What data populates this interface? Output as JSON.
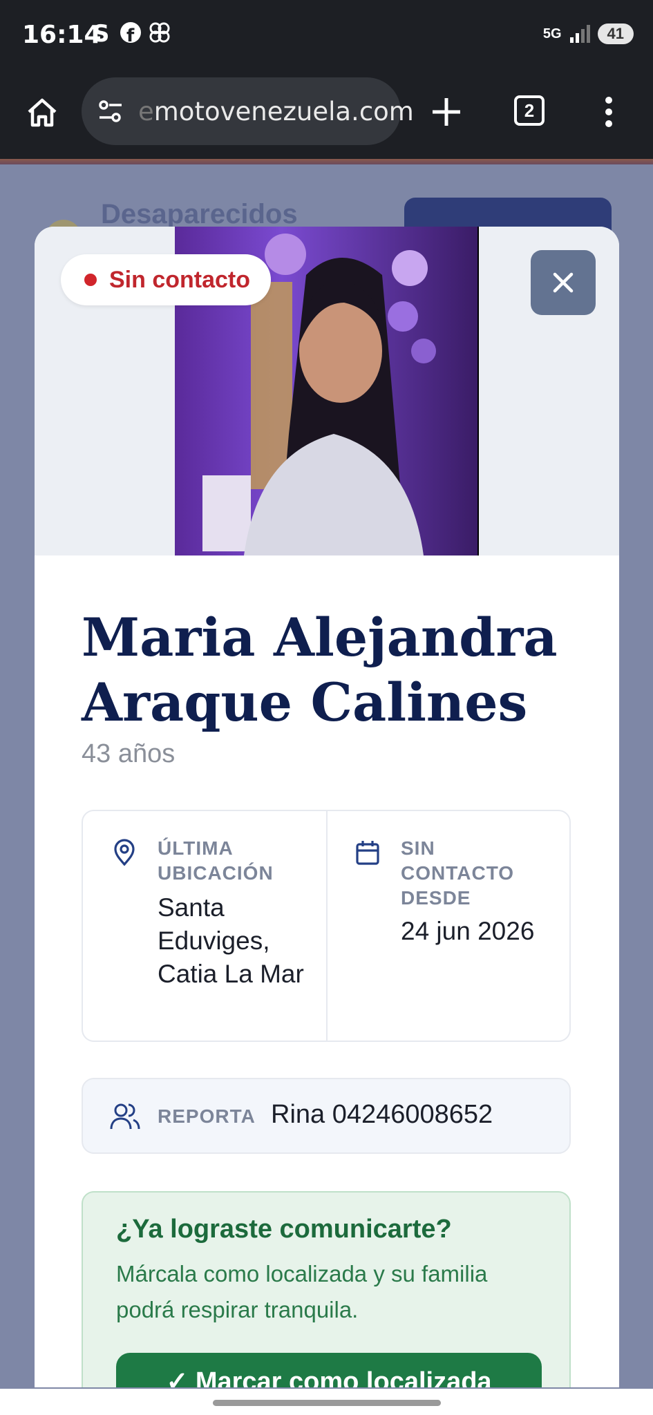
{
  "status_bar": {
    "time": "16:14",
    "network": "5G",
    "battery": "41",
    "app_icons": [
      "skype-icon",
      "facebook-icon",
      "pinwheel-icon"
    ]
  },
  "browser": {
    "url_prefix": "e",
    "url": "motovenezuela.com",
    "tab_count": "2"
  },
  "background": {
    "title": "Desaparecidos"
  },
  "modal": {
    "status_badge": "Sin contacto",
    "name": "Maria Alejandra Araque Calines",
    "age": "43 años",
    "last_location_label": "ÚLTIMA UBICACIÓN",
    "last_location_value": "Santa Eduviges, Catia La Mar",
    "no_contact_label": "SIN CONTACTO DESDE",
    "no_contact_value": "24 jun 2026",
    "report_label": "REPORTA",
    "report_value": "Rina 04246008652",
    "found_title": "¿Ya lograste comunicarte?",
    "found_text": "Márcala como localizada y su familia podrá respirar tranquila.",
    "found_button": "✓ Marcar como localizada"
  },
  "colors": {
    "primary_navy": "#0f1f4f",
    "status_red": "#d1252b",
    "success_green": "#1e7a45",
    "close_button": "#637391"
  }
}
